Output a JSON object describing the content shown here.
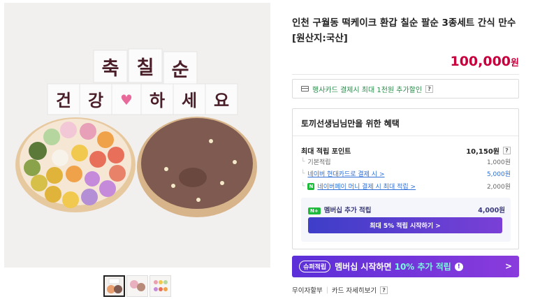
{
  "product": {
    "title": "인천 구월동 떡케이크 환갑 칠순 팔순 3종세트 간식 만수 [원산지:국산]",
    "price": "100,000",
    "currency": "원"
  },
  "gallery": {
    "main_image": "rice-cake-set-photo",
    "sign_top": [
      "축",
      "칠",
      "순"
    ],
    "sign_bottom": [
      "건",
      "강",
      "♥",
      "하",
      "세",
      "요"
    ],
    "thumbnails": [
      "thumb-1",
      "thumb-2",
      "thumb-3"
    ]
  },
  "card_benefit": {
    "label": "행사카드 결제시 최대 1천원 추가할인",
    "help": "?"
  },
  "benefits": {
    "heading": "토끼선생님님만을 위한 혜택",
    "points_label": "최대 적립 포인트",
    "points_value": "10,150원",
    "help": "?",
    "rows": [
      {
        "label": "기본적립",
        "value": "1,000원"
      },
      {
        "label": "네이버 현대카드로 결제 시 >",
        "value": "5,000원"
      },
      {
        "label": "네이버페이 머니 결제 시 최대 적립 >",
        "value": "2,000원"
      }
    ],
    "member": {
      "tag": "N+",
      "label": "멤버십 추가 적립",
      "value": "4,000원",
      "button": "최대 5% 적립 시작하기 >"
    }
  },
  "super_banner": {
    "tag": "슈퍼적립",
    "text": "멤버십 시작하면",
    "highlight": "10% 추가 적립",
    "icon": "!",
    "arrow": ">"
  },
  "footer": {
    "link1": "무이자할부",
    "link2": "카드 자세히보기",
    "help": "?"
  }
}
